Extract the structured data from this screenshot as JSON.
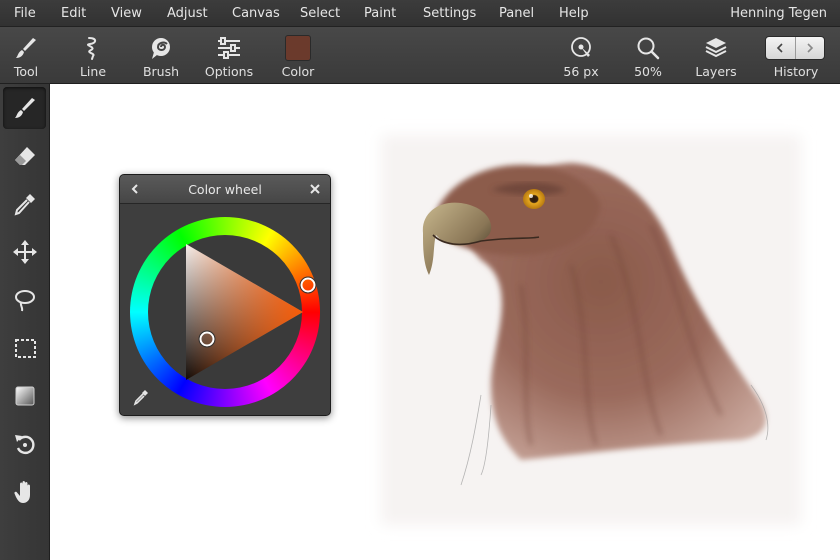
{
  "menubar": {
    "items": [
      "File",
      "Edit",
      "View",
      "Adjust",
      "Canvas",
      "Select",
      "Paint",
      "Settings",
      "Panel",
      "Help"
    ],
    "user": "Henning Tegen"
  },
  "toolbar": {
    "tool_label": "Tool",
    "line_label": "Line",
    "brush_label": "Brush",
    "options_label": "Options",
    "color_label": "Color",
    "size_label": "56 px",
    "zoom_label": "50%",
    "layers_label": "Layers",
    "history_label": "History",
    "current_color": "#6b3a2c"
  },
  "left_tools": [
    "brush-tool",
    "eraser-tool",
    "eyedropper-tool",
    "move-tool",
    "lasso-tool",
    "marquee-tool",
    "gradient-tool",
    "rotate-tool",
    "hand-tool"
  ],
  "color_panel": {
    "title": "Color wheel",
    "hue_color": "#ff5a00"
  }
}
